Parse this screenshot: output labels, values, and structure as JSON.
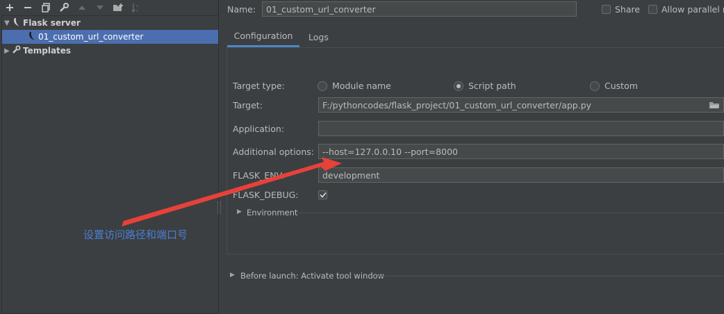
{
  "toolbar": {
    "icons": [
      "add-icon",
      "remove-icon",
      "copy-icon",
      "wrench-icon",
      "move-up-icon",
      "move-down-icon",
      "folder-add-icon",
      "sort-icon"
    ]
  },
  "tree": {
    "group_label": "Flask server",
    "config_label": "01_custom_url_converter",
    "templates_label": "Templates"
  },
  "header": {
    "name_label": "Name:",
    "name_value": "01_custom_url_converter",
    "share_label": "Share",
    "allow_parallel_label": "Allow parallel ru"
  },
  "tabs": [
    {
      "label": "Configuration",
      "active": true
    },
    {
      "label": "Logs",
      "active": false
    }
  ],
  "form": {
    "target_type_label": "Target type:",
    "target_types": [
      {
        "label": "Module name",
        "selected": false
      },
      {
        "label": "Script path",
        "selected": true
      },
      {
        "label": "Custom",
        "selected": false
      }
    ],
    "target_label": "Target:",
    "target_value": "F:/pythoncodes/flask_project/01_custom_url_converter/app.py",
    "application_label": "Application:",
    "application_value": "",
    "additional_options_label": "Additional options:",
    "additional_options_value": "--host=127.0.0.10 --port=8000",
    "flask_env_label": "FLASK_ENV:",
    "flask_env_value": "development",
    "flask_debug_label": "FLASK_DEBUG:",
    "flask_debug_checked": true,
    "environment_label": "Environment"
  },
  "before_launch_label": "Before launch: Activate tool window",
  "annotation": {
    "text": "设置访问路径和端口号",
    "color": "#4a7fd4",
    "arrow_color": "#e8413a"
  },
  "colors": {
    "background": "#3c3f41",
    "selection": "#4b6eaf",
    "tab_underline": "#4a88c7",
    "field_background": "#45494a"
  }
}
